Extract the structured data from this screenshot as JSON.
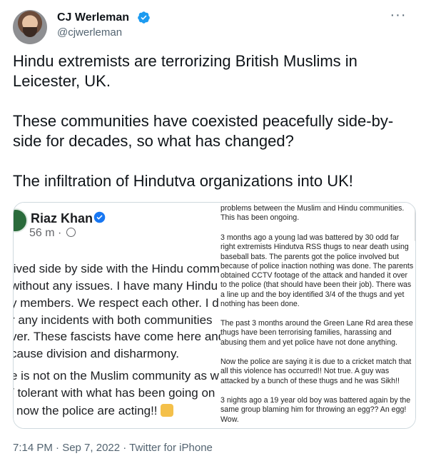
{
  "author": {
    "name": "CJ Werleman",
    "handle": "@cjwerleman"
  },
  "tweet": {
    "paragraphs": [
      "Hindu extremists are terrorizing British Muslims in Leicester, UK.",
      "These communities have coexisted peacefully side-by-side for decades, so what has changed?",
      "The infiltration of Hindutva organizations into UK!"
    ]
  },
  "media": {
    "left": {
      "name": "Riaz Khan",
      "time": "56 m ·",
      "lines": [
        "lived side by side with the Hindu comm",
        "without any issues. I have many Hindu",
        "y members. We respect each other. I d",
        "r any incidents with both communities",
        "ver. These fascists have come here and",
        "cause division and disharmony.",
        "e is not on the Muslim community as w",
        "/ tolerant with what has been going on",
        "now the police are acting!!"
      ]
    },
    "right": {
      "paragraphs": [
        "problems between the Muslim and Hindu communities. This has been ongoing.",
        "3 months ago a young lad was battered by 30 odd far right extremists Hindutva RSS thugs to near death using baseball bats. The parents got the police involved but because of police inaction nothing was done. The parents obtained CCTV footage of the attack and handed it over to the police (that should have been their job). There was a line up and the boy identified 3/4 of the thugs and yet nothing has been done.",
        "The past 3 months around the Green Lane Rd area these thugs have been terrorising families, harassing and abusing them and yet police have not done anything.",
        "Now the police are saying it is due to a cricket match that all this violence has occurred!! Not true. A guy was attacked by a bunch of these thugs and he was Sikh!!",
        "3 nights ago a 19 year old boy was battered again by the same group blaming him for throwing an egg?? An egg! Wow."
      ]
    }
  },
  "meta": {
    "timestamp": "7:14 PM · Sep 7, 2022 · Twitter for iPhone"
  },
  "colors": {
    "verified": "#1d9bf0",
    "muted": "#536471",
    "border": "#cfd9de"
  }
}
